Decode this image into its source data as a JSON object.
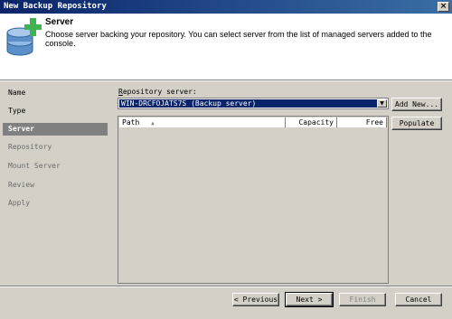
{
  "window": {
    "title": "New Backup Repository",
    "close_label": "×"
  },
  "header": {
    "title": "Server",
    "description": "Choose server backing your repository. You can select server from the list of managed servers added to the console.",
    "icon": "repository-add-icon"
  },
  "steps": [
    {
      "label": "Name",
      "state": "done"
    },
    {
      "label": "Type",
      "state": "done"
    },
    {
      "label": "Server",
      "state": "active"
    },
    {
      "label": "Repository",
      "state": "todo"
    },
    {
      "label": "Mount Server",
      "state": "todo"
    },
    {
      "label": "Review",
      "state": "todo"
    },
    {
      "label": "Apply",
      "state": "todo"
    }
  ],
  "repository_server": {
    "label_prefix": "R",
    "label_rest": "epository server:",
    "selected": "WIN-DRCFOJATS7S (Backup server)"
  },
  "table": {
    "columns": [
      "Path",
      "Capacity",
      "Free"
    ],
    "sort_indicator": "▲",
    "rows": []
  },
  "side_buttons": {
    "add_new": "Add New...",
    "populate": "Populate"
  },
  "footer_buttons": {
    "previous": "< Previous",
    "next": "Next >",
    "finish": "Finish",
    "cancel": "Cancel"
  }
}
